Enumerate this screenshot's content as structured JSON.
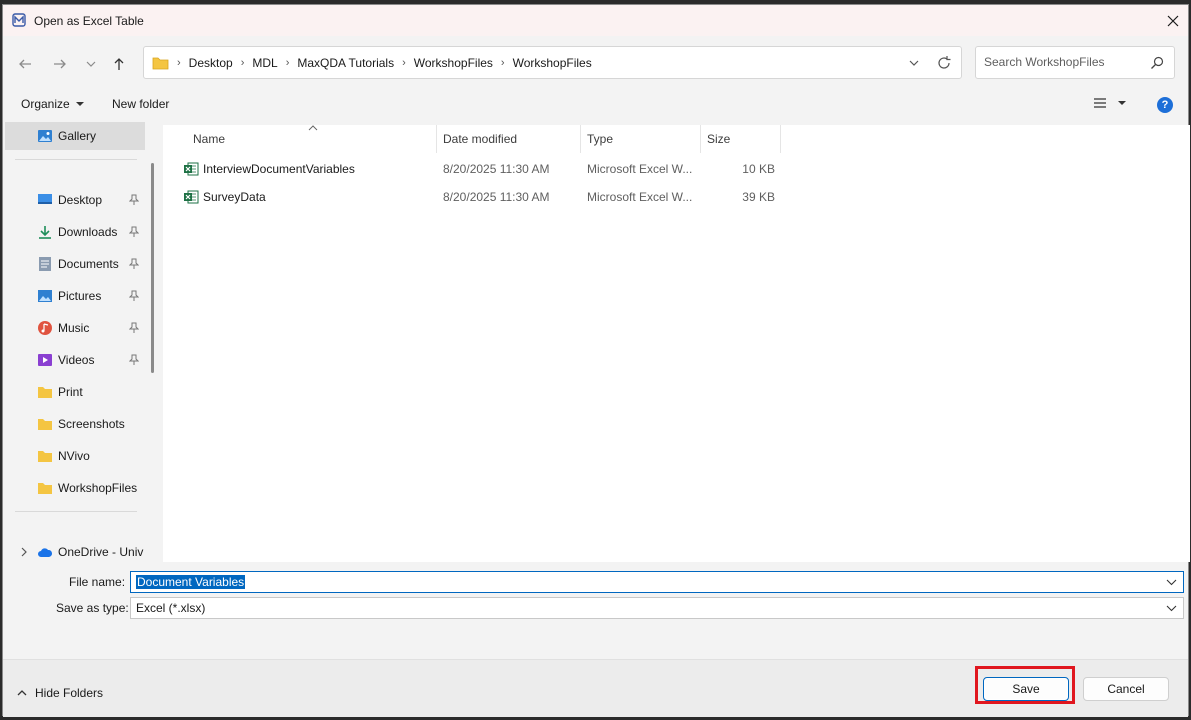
{
  "window": {
    "title": "Open as Excel Table"
  },
  "address": {
    "breadcrumbs": [
      "Desktop",
      "MDL",
      "MaxQDA Tutorials",
      "WorkshopFiles",
      "WorkshopFiles"
    ]
  },
  "search": {
    "placeholder": "Search WorkshopFiles"
  },
  "toolbar": {
    "organize_label": "Organize",
    "new_folder_label": "New folder"
  },
  "nav": {
    "gallery": "Gallery",
    "quick_access": [
      {
        "label": "Desktop",
        "icon": "desktop-icon"
      },
      {
        "label": "Downloads",
        "icon": "download-icon"
      },
      {
        "label": "Documents",
        "icon": "documents-icon"
      },
      {
        "label": "Pictures",
        "icon": "pictures-icon"
      },
      {
        "label": "Music",
        "icon": "music-icon"
      },
      {
        "label": "Videos",
        "icon": "videos-icon"
      },
      {
        "label": "Print",
        "icon": "folder-icon"
      },
      {
        "label": "Screenshots",
        "icon": "folder-icon"
      },
      {
        "label": "NVivo",
        "icon": "folder-icon"
      },
      {
        "label": "WorkshopFiles",
        "icon": "folder-icon"
      }
    ],
    "onedrive": "OneDrive - Univ"
  },
  "columns": {
    "name": "Name",
    "date": "Date modified",
    "type": "Type",
    "size": "Size"
  },
  "files": [
    {
      "name": "InterviewDocumentVariables",
      "date": "8/20/2025 11:30 AM",
      "type": "Microsoft Excel W...",
      "size": "10 KB"
    },
    {
      "name": "SurveyData",
      "date": "8/20/2025 11:30 AM",
      "type": "Microsoft Excel W...",
      "size": "39 KB"
    }
  ],
  "form": {
    "file_name_label": "File name:",
    "file_name_value": "Document Variables",
    "save_type_label": "Save as type:",
    "save_type_value": "Excel (*.xlsx)"
  },
  "footer": {
    "hide_folders_label": "Hide Folders",
    "save_label": "Save",
    "cancel_label": "Cancel"
  },
  "colors": {
    "accent": "#0067c0",
    "highlight": "#e0161e",
    "excel_green": "#1e7145",
    "folder_yellow": "#f4c542"
  }
}
